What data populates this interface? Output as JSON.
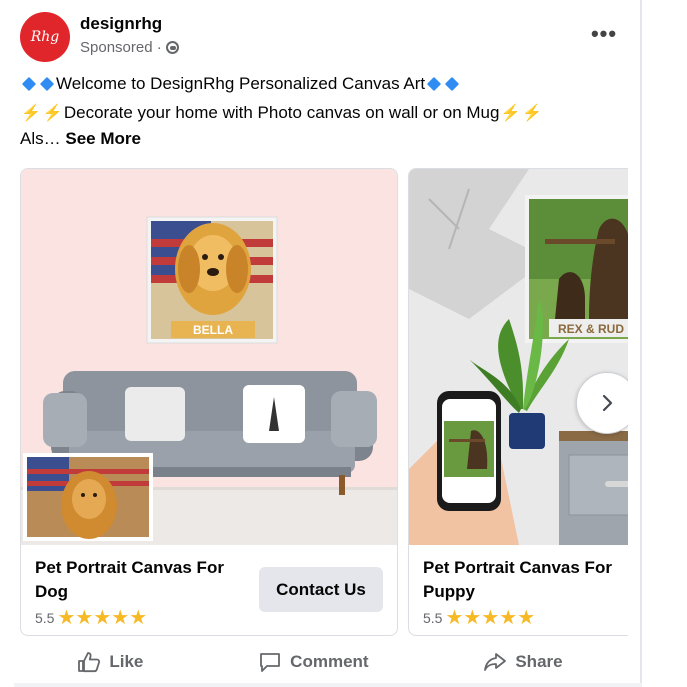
{
  "post": {
    "page_name": "designrhg",
    "avatar_text": "Rhg",
    "sponsored": "Sponsored ·",
    "line1": "Welcome to DesignRhg Personalized Canvas Art",
    "line2": "Decorate your home with Photo canvas on wall or on Mug",
    "line3": "Als…",
    "see_more": "See More"
  },
  "carousel": {
    "items": [
      {
        "title": "Pet Portrait Canvas For Dog",
        "rating": "5.5",
        "stars": "★★★★★",
        "button": "Contact Us",
        "frame_label": "BELLA"
      },
      {
        "title": "Pet Portrait Canvas For Puppy",
        "rating": "5.5",
        "stars": "★★★★★",
        "frame_label": "REX & RUD"
      }
    ]
  },
  "actions": {
    "like": "Like",
    "comment": "Comment",
    "share": "Share"
  },
  "colors": {
    "accent_red": "#e0262b",
    "diamond_blue": "#2f8cf3",
    "star_gold": "#f7b924",
    "secondary_text": "#65676b"
  }
}
